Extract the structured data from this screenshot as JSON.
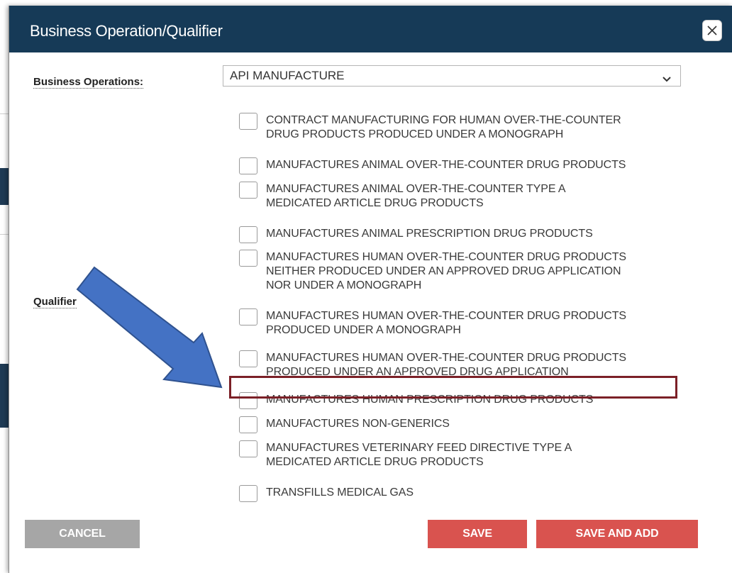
{
  "dialog": {
    "title": "Business Operation/Qualifier",
    "close_icon": "close-icon"
  },
  "form": {
    "business_operations_label": "Business Operations:",
    "business_operations_value": "API MANUFACTURE",
    "qualifier_label": "Qualifier"
  },
  "qualifiers": [
    {
      "lines": [
        "CONTRACT MANUFACTURING FOR HUMAN OVER-THE-COUNTER",
        "DRUG PRODUCTS PRODUCED UNDER A MONOGRAPH"
      ],
      "checked": false
    },
    {
      "lines": [
        "MANUFACTURES ANIMAL OVER-THE-COUNTER DRUG PRODUCTS"
      ],
      "checked": false
    },
    {
      "lines": [
        "MANUFACTURES ANIMAL OVER-THE-COUNTER TYPE A",
        "MEDICATED ARTICLE DRUG PRODUCTS"
      ],
      "checked": false
    },
    {
      "lines": [
        "MANUFACTURES ANIMAL PRESCRIPTION DRUG PRODUCTS"
      ],
      "checked": false
    },
    {
      "lines": [
        "MANUFACTURES HUMAN OVER-THE-COUNTER DRUG PRODUCTS",
        "NEITHER PRODUCED UNDER AN APPROVED DRUG APPLICATION",
        "NOR UNDER A MONOGRAPH"
      ],
      "checked": false
    },
    {
      "lines": [
        "MANUFACTURES HUMAN OVER-THE-COUNTER DRUG PRODUCTS",
        "PRODUCED UNDER A MONOGRAPH"
      ],
      "checked": false
    },
    {
      "lines": [
        "MANUFACTURES HUMAN OVER-THE-COUNTER DRUG PRODUCTS",
        "PRODUCED UNDER AN APPROVED DRUG APPLICATION"
      ],
      "checked": false
    },
    {
      "lines": [
        "MANUFACTURES HUMAN PRESCRIPTION DRUG PRODUCTS"
      ],
      "checked": false,
      "highlighted": true
    },
    {
      "lines": [
        "MANUFACTURES NON-GENERICS"
      ],
      "checked": false
    },
    {
      "lines": [
        "MANUFACTURES VETERINARY FEED DIRECTIVE TYPE A",
        "MEDICATED ARTICLE DRUG PRODUCTS"
      ],
      "checked": false
    },
    {
      "lines": [
        "TRANSFILLS MEDICAL GAS"
      ],
      "checked": false
    }
  ],
  "buttons": {
    "cancel": "CANCEL",
    "save": "SAVE",
    "save_and_add": "SAVE AND ADD"
  },
  "colors": {
    "header": "#163a57",
    "primary_button": "#d9534f",
    "cancel_button": "#a6a6a6",
    "highlight": "#7b2027",
    "annotation_arrow": "#4472c4"
  }
}
